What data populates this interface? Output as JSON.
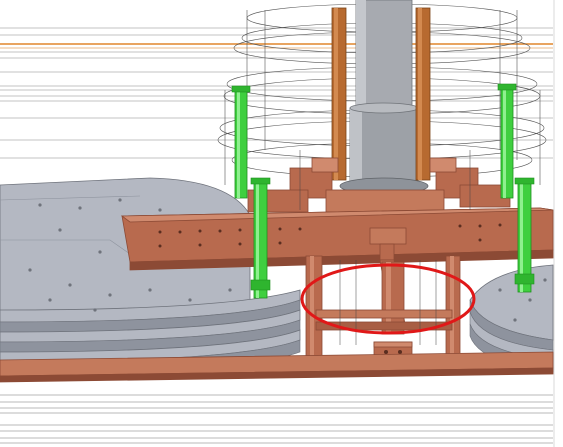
{
  "viewport": {
    "label": "",
    "colors": {
      "background": "#ffffff",
      "copper": "#b86a4e",
      "copper_dark": "#8c4a35",
      "copper_light": "#d08a6e",
      "steel_plate": "#b4b8c2",
      "steel_plate_dark": "#8e939e",
      "column": "#a7aab0",
      "column_dark": "#7f8388",
      "standoff": "#3fcf3f",
      "standoff_dark": "#1f8f1f",
      "rod": "#b76a30",
      "highlight": "#e01818",
      "wireframe": "#555555",
      "orange_line": "#e0862c"
    },
    "highlight": {
      "shape": "ellipse",
      "color_name": "red"
    },
    "standoff_count": 4,
    "rod_count": 2
  }
}
